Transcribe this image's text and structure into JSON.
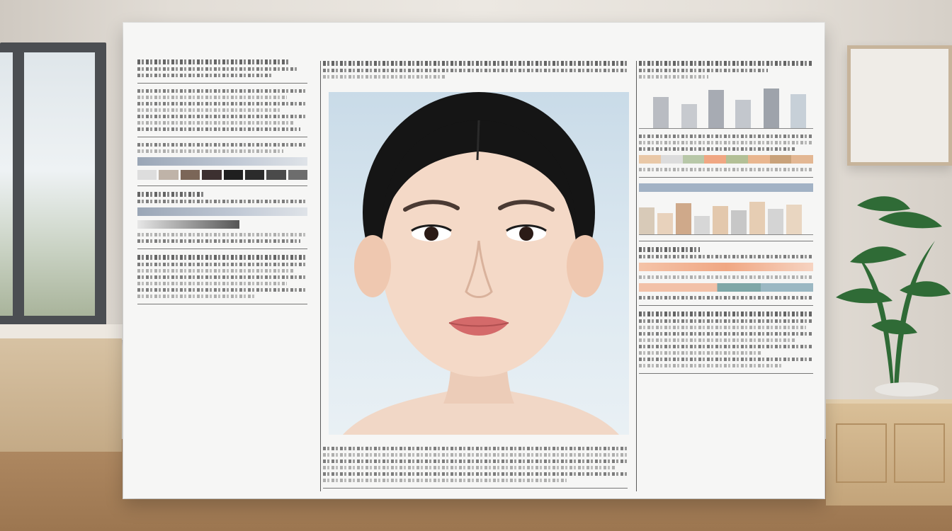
{
  "scene": {
    "description_visible_text": "",
    "poster": {
      "left_column_blocks": 6,
      "right_column_blocks": 5
    }
  },
  "colors": {
    "poster_bg": "#f6f6f5",
    "photo_bg": "#d6e5ef",
    "accent_peach": "#f0b08c",
    "accent_teal": "#7fa7a7",
    "accent_gray": "#9aa6b6"
  },
  "icons": [
    "plant-icon",
    "window-icon",
    "frame-icon"
  ]
}
